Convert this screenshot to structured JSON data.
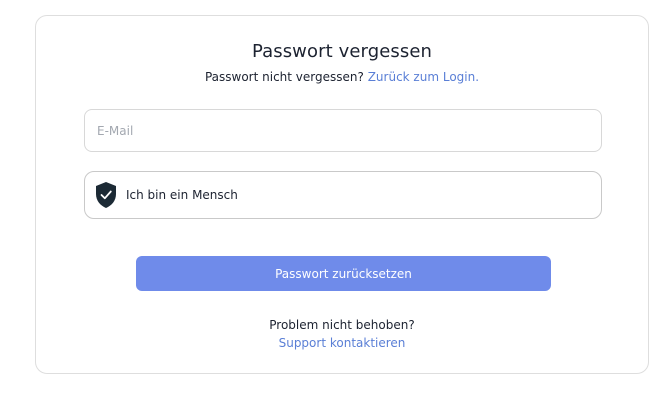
{
  "form": {
    "title": "Passwort vergessen",
    "subtitle_text": "Passwort nicht vergessen?",
    "login_link": "Zurück zum Login.",
    "email_placeholder": "E-Mail",
    "email_value": "",
    "captcha_label": "Ich bin ein Mensch",
    "captcha_icon": "shield-check-icon",
    "submit_label": "Passwort zurücksetzen",
    "problem_text": "Problem nicht behoben?",
    "support_link": "Support kontaktieren"
  },
  "colors": {
    "accent": "#6f8bea",
    "link": "#5a7fd6",
    "shield": "#1c2a35",
    "text": "#1c2230",
    "border": "#d8d8d8"
  }
}
